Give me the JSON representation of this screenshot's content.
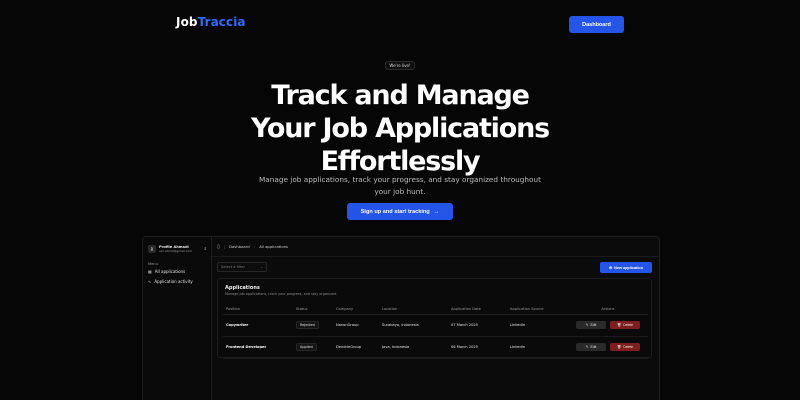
{
  "nav": {
    "logo_part1": "Job",
    "logo_part2": "Traccia",
    "dashboard_label": "Dashboard"
  },
  "hero": {
    "badge": "We're live!",
    "title_lines": [
      "Track and Manage",
      "Your Job Applications",
      "Effortlessly"
    ],
    "subtitle_line1": "Manage job applications, track your progress, and stay organized throughout",
    "subtitle_line2": "your job hunt.",
    "cta_label": "Sign up and start tracking",
    "cta_arrow": "→"
  },
  "app": {
    "user": {
      "initial": "R",
      "name": "Profile Ahmadi",
      "email": "ren.ahmd@gmail.com"
    },
    "menu_title": "Menu",
    "menu_items": [
      {
        "label": "All applications",
        "icon": "grid-icon"
      },
      {
        "label": "Application activity",
        "icon": "activity-icon"
      }
    ],
    "breadcrumb": [
      "Dashboard",
      "All applications"
    ],
    "filter_placeholder": "Select a filter",
    "new_application_label": "New application",
    "card": {
      "title": "Applications",
      "description": "Manage job applications, track your progress, and stay organized."
    },
    "table": {
      "headers": [
        "Position",
        "Status",
        "Company",
        "Location",
        "Application Date",
        "Application Source",
        "Actions"
      ],
      "rows": [
        {
          "position": "Copywriter",
          "status": "Rejected",
          "company": "NanonGroup",
          "location": "Surabaya, Indonesia",
          "date": "07 March 2025",
          "source": "LinkedIn"
        },
        {
          "position": "Frontend Developer",
          "status": "Applied",
          "company": "DendrieGroup",
          "location": "Java, Indonesia",
          "date": "06 March 2025",
          "source": "LinkedIn"
        }
      ],
      "edit_label": "Edit",
      "delete_label": "Delete"
    }
  },
  "colors": {
    "accent": "#2454e8",
    "logo_accent": "#2f6bff",
    "delete": "#7e1e1e",
    "background": "#060606"
  }
}
